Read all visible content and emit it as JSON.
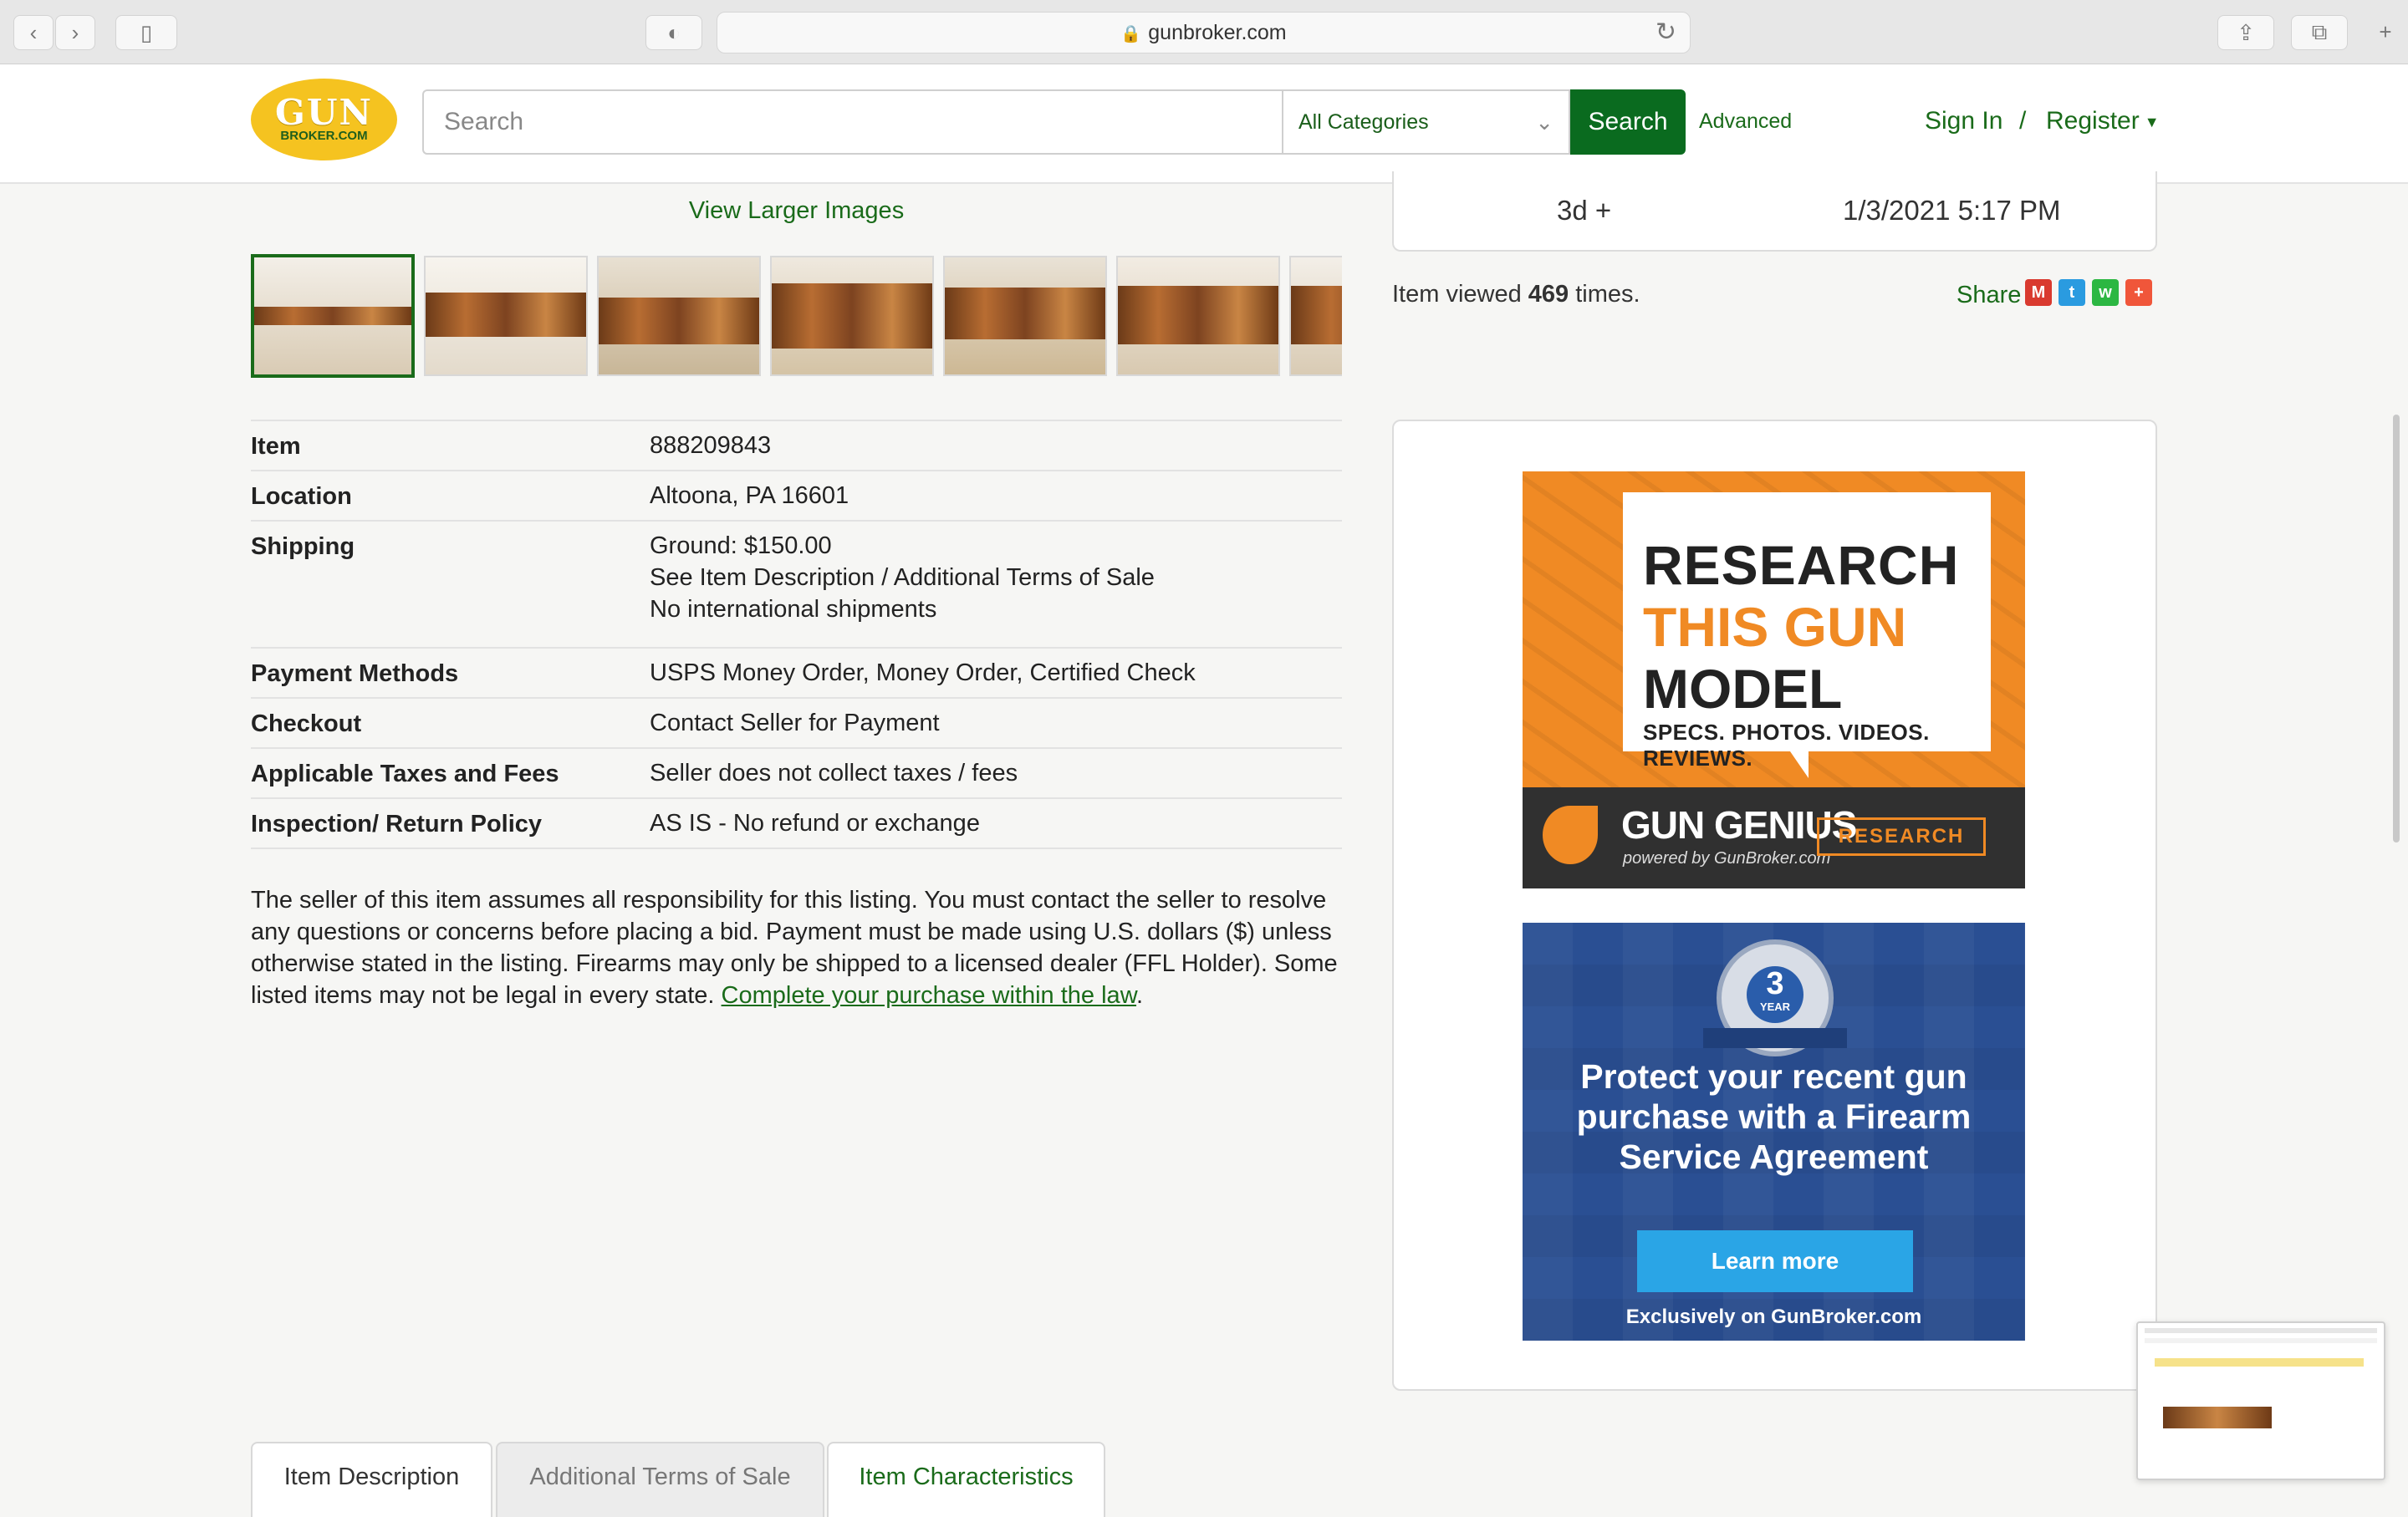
{
  "browser": {
    "url": "gunbroker.com"
  },
  "header": {
    "logo_top": "GUN",
    "logo_bottom": "BROKER.COM",
    "search_placeholder": "Search",
    "category": "All Categories",
    "search_button": "Search",
    "advanced": "Advanced",
    "sign_in": "Sign In",
    "separator": "/",
    "register": "Register"
  },
  "gallery": {
    "view_larger": "View Larger Images"
  },
  "details": [
    {
      "label": "Item",
      "value": [
        "888209843"
      ]
    },
    {
      "label": "Location",
      "value": [
        "Altoona, PA 16601"
      ]
    },
    {
      "label": "Shipping",
      "value": [
        "Ground: $150.00",
        "See Item Description / Additional Terms of Sale",
        "No international shipments"
      ]
    },
    {
      "label": "Payment Methods",
      "value": [
        "USPS Money Order, Money Order, Certified Check"
      ]
    },
    {
      "label": "Checkout",
      "value": [
        "Contact Seller for Payment"
      ]
    },
    {
      "label": "Applicable Taxes and Fees",
      "value": [
        "Seller does not collect taxes / fees"
      ]
    },
    {
      "label": "Inspection/ Return Policy",
      "value": [
        "AS IS - No refund or exchange"
      ]
    }
  ],
  "disclaimer": {
    "text": "The seller of this item assumes all responsibility for this listing. You must contact the seller to resolve any questions or concerns before placing a bid. Payment must be made using U.S. dollars ($) unless otherwise stated in the listing. Firearms may only be shipped to a licensed dealer (FFL Holder). Some listed items may not be legal in every state. ",
    "link": "Complete your purchase within the law",
    "end": "."
  },
  "auction": {
    "time_left": "3d +",
    "end_time": "1/3/2021 5:17 PM",
    "viewed_prefix": "Item viewed ",
    "viewed_count": "469",
    "viewed_suffix": " times.",
    "share": "Share"
  },
  "share_icons": [
    {
      "icon": "gmail-icon",
      "glyph": "M",
      "color": "#d93a2f"
    },
    {
      "icon": "twitter-icon",
      "glyph": "t",
      "color": "#2a9be0"
    },
    {
      "icon": "whatsapp-icon",
      "glyph": "w",
      "color": "#2cb742"
    },
    {
      "icon": "more-share-icon",
      "glyph": "+",
      "color": "#f0563a"
    }
  ],
  "ad_research": {
    "line1": "RESEARCH",
    "line2": "THIS GUN",
    "line3": "MODEL",
    "line4": "SPECS. PHOTOS. VIDEOS. REVIEWS.",
    "brand": "GUN GENIUS",
    "brand_sub": "powered by GunBroker.com",
    "button": "RESEARCH",
    "accent": "#f08a24"
  },
  "ad_protect": {
    "badge_number": "3",
    "badge_unit": "YEAR",
    "headline": "Protect your recent gun purchase with a Firearm Service Agreement",
    "button": "Learn more",
    "footer": "Exclusively on GunBroker.com",
    "color": "#2a4f93"
  },
  "tabs": [
    "Item Description",
    "Additional Terms of Sale",
    "Item Characteristics"
  ],
  "colors": {
    "brand_green": "#0a6b1f",
    "link_green": "#1a6b1a",
    "logo_yellow": "#f5c320"
  }
}
